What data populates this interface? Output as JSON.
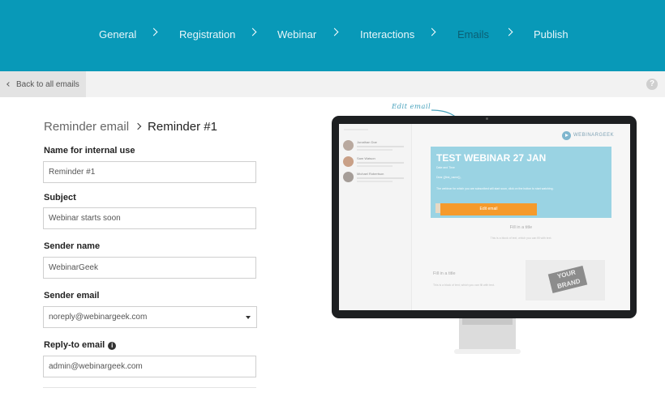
{
  "steps": [
    {
      "label": "General"
    },
    {
      "label": "Registration"
    },
    {
      "label": "Webinar"
    },
    {
      "label": "Interactions"
    },
    {
      "label": "Emails"
    },
    {
      "label": "Publish"
    }
  ],
  "active_step": "Emails",
  "subbar": {
    "back_label": "Back to all emails",
    "help_icon": "?"
  },
  "breadcrumb": {
    "parent": "Reminder email",
    "current": "Reminder #1"
  },
  "form": {
    "internal_name": {
      "label": "Name for internal use",
      "value": "Reminder #1"
    },
    "subject": {
      "label": "Subject",
      "value": "Webinar starts soon"
    },
    "sender_name": {
      "label": "Sender name",
      "value": "WebinarGeek"
    },
    "sender_email": {
      "label": "Sender email",
      "value": "noreply@webinargeek.com"
    },
    "reply_to": {
      "label": "Reply-to email",
      "info_icon": "i",
      "value": "admin@webinargeek.com"
    }
  },
  "preview": {
    "edit_note": "Edit email",
    "contacts": [
      {
        "name": "Jonathan Doe"
      },
      {
        "name": "Sam Watson"
      },
      {
        "name": "Michael Robertson"
      }
    ],
    "logo_text": "WEBINARGEEK",
    "banner": {
      "title": "TEST WEBINAR 27 JAN",
      "date_line": "Date and Time",
      "greeting": "Dear {{first_name}},",
      "body": "The webinar for which you are subscribed will start soon, click on the button to start watching."
    },
    "edit_button": "Edit email",
    "fill_title_1": "Fill in a title",
    "fill_body_1": "This is a block of text, which you can fill with text.",
    "fill_title_2": "Fill in a title",
    "fill_body_2": "This is a block of text, which you can fill with text.",
    "brand_image_text": "YOUR BRAND"
  },
  "colors": {
    "nav": "#0899b8",
    "active_step": "#0b5f74",
    "accent_orange": "#f59a2b",
    "banner": "#9ad3e3"
  }
}
